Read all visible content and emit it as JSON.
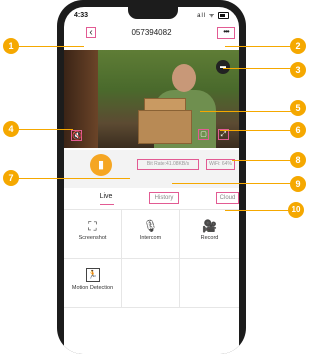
{
  "status_bar": {
    "time": "4:33",
    "icons": "all ᯤ"
  },
  "navbar": {
    "back_symbol": "‹",
    "title": "057394082",
    "more_symbol": "•••"
  },
  "video": {
    "sd_label": "▬",
    "mute_symbol": "🔇",
    "clarity_symbol": "▢",
    "fullscreen_symbol": "⤢"
  },
  "info": {
    "device_symbol": "▮",
    "bitrate": "Bit Rate:41.08KB/s",
    "wifi": "WiFi: 64%"
  },
  "tabs": {
    "live": "Live",
    "history": "History",
    "cloud": "Cloud"
  },
  "features": {
    "screenshot": "Screenshot",
    "intercom": "Intercom",
    "record": "Record",
    "motion_detection": "Motion Detection"
  },
  "callouts": [
    "1",
    "2",
    "3",
    "4",
    "5",
    "6",
    "7",
    "8",
    "9",
    "10"
  ],
  "accent_color": "#f5a800",
  "highlight_color": "#e25b93"
}
